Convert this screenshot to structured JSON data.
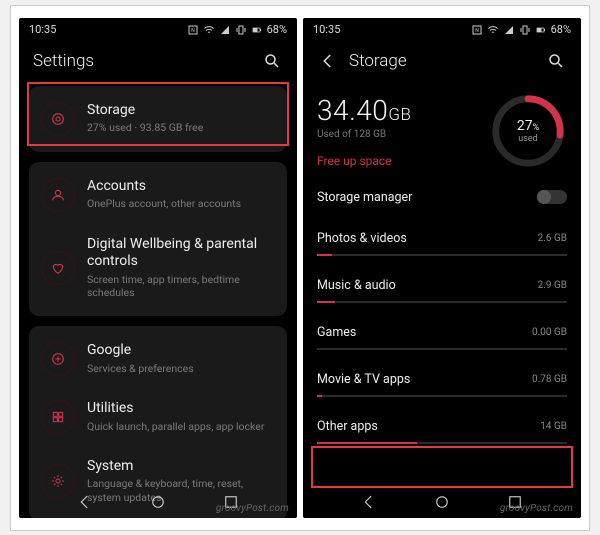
{
  "status": {
    "time": "10:35",
    "battery": "68%"
  },
  "left": {
    "title": "Settings",
    "items": [
      {
        "title": "Storage",
        "sub": "27% used · 93.85 GB free"
      },
      {
        "title": "Accounts",
        "sub": "OnePlus account, other accounts"
      },
      {
        "title": "Digital Wellbeing & parental controls",
        "sub": "Screen time, app timers, bedtime schedules"
      },
      {
        "title": "Google",
        "sub": "Services & preferences"
      },
      {
        "title": "Utilities",
        "sub": "Quick launch, parallel apps, app locker"
      },
      {
        "title": "System",
        "sub": "Language & keyboard, time, reset, system updates"
      }
    ]
  },
  "right": {
    "title": "Storage",
    "used_val": "34.40",
    "used_unit": "GB",
    "used_of": "Used of 128 GB",
    "ring_pct": "27",
    "ring_pct_sym": "%",
    "ring_sub": "used",
    "free_up": "Free up space",
    "storage_mgr": "Storage manager",
    "categories": [
      {
        "label": "Photos & videos",
        "value": "2.6 GB",
        "pct": 6
      },
      {
        "label": "Music & audio",
        "value": "2.9 GB",
        "pct": 7
      },
      {
        "label": "Games",
        "value": "0.00 GB",
        "pct": 0
      },
      {
        "label": "Movie & TV apps",
        "value": "0.78 GB",
        "pct": 2
      },
      {
        "label": "Other apps",
        "value": "14 GB",
        "pct": 40
      }
    ]
  },
  "watermark": "groovyPost.com",
  "colors": {
    "accent": "#d1344a",
    "hl": "#e63a3a"
  }
}
